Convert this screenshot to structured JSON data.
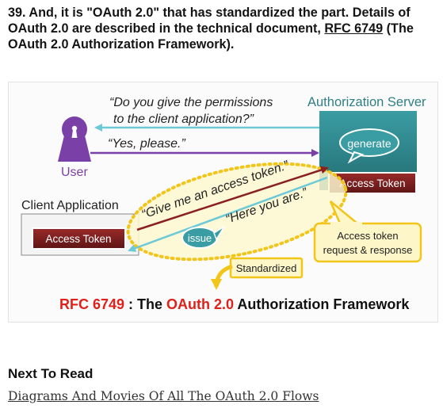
{
  "heading": {
    "prefix": "39. And, it is \"OAuth 2.0\" that has standardized the part. Details of OAuth 2.0 are described in the technical document, ",
    "link": "RFC 6749",
    "suffix": " (The OAuth 2.0 Authorization Framework)."
  },
  "figure": {
    "quote_permission_1": "“Do you give the permissions",
    "quote_permission_2": "to the client application?”",
    "quote_yes": "“Yes, please.”",
    "auth_server_label": "Authorization Server",
    "generate_label": "generate",
    "user_label": "User",
    "client_label": "Client Application",
    "access_token_server": "Access Token",
    "access_token_client": "Access Token",
    "quote_give": "“Give me an access token.”",
    "quote_here": "“Here you are.”",
    "issue_label": "issue",
    "request_response_1": "Access token",
    "request_response_2": "request & response",
    "standardized_label": "Standardized",
    "footer_rfc": "RFC 6749",
    "footer_sep": " : The ",
    "footer_oauth": "OAuth 2.0",
    "footer_rest": " Authorization Framework"
  },
  "next": {
    "title": "Next To Read",
    "link": "Diagrams And Movies Of All The OAuth 2.0 Flows"
  },
  "colors": {
    "purple": "#7b3fa8",
    "teal": "#2f8f93",
    "cyan_arrow": "#6cc9d8",
    "red_text": "#e0201b",
    "token_red": "#7a1f1f",
    "yellow": "#f2d21a",
    "callout_fill": "#fdf6c8"
  }
}
